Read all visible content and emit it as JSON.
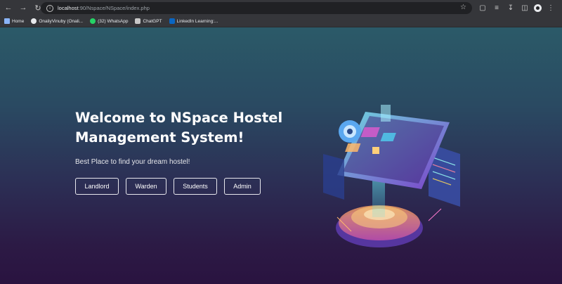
{
  "browser": {
    "url_host": "localhost",
    "url_rest": ":90/Nspace/NSpace/index.php",
    "bookmarks": [
      {
        "label": "Home"
      },
      {
        "label": "OnaliyVinuby (Onali..."
      },
      {
        "label": "(32) WhatsApp"
      },
      {
        "label": "ChatGPT"
      },
      {
        "label": "LinkedIn Learning:..."
      }
    ]
  },
  "hero": {
    "title": "Welcome to NSpace Hostel Management System!",
    "subtitle": "Best Place to find your dream hostel!",
    "buttons": {
      "landlord": "Landlord",
      "warden": "Warden",
      "students": "Students",
      "admin": "Admin"
    }
  },
  "colors": {
    "chrome": "#35363a",
    "page_top": "#2b5a68",
    "page_bottom": "#2a1340",
    "accent_cyan": "#4ee6f0",
    "accent_purple": "#9b5cf0"
  }
}
